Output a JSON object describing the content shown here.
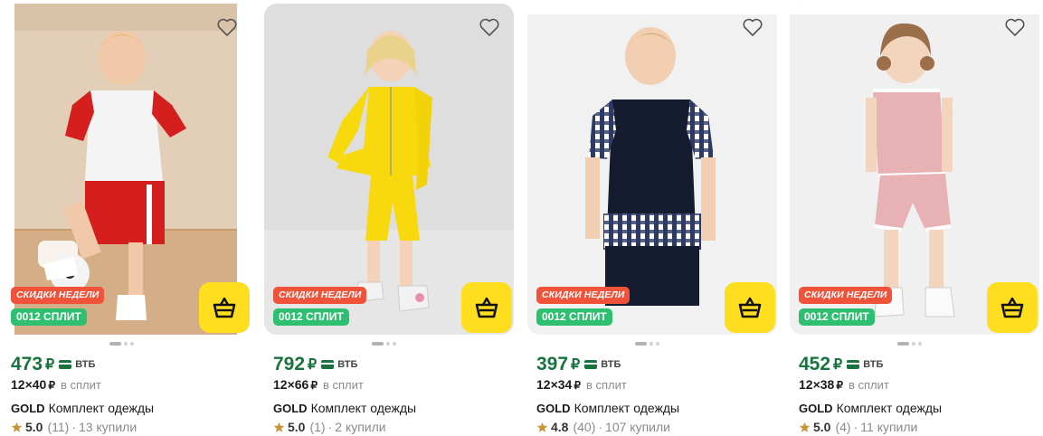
{
  "products": [
    {
      "price": "473",
      "currency": "₽",
      "bank": "ВТБ",
      "split_amount": "12×40",
      "split_currency": "₽",
      "split_label": "в сплит",
      "brand": "GOLD",
      "title": "Комплект одежды",
      "rating": "5.0",
      "reviews": "(11)",
      "separator": "·",
      "bought": "13 купили",
      "badge_sale": "СКИДКИ НЕДЕЛИ",
      "badge_split": "0012 СПЛИТ"
    },
    {
      "price": "792",
      "currency": "₽",
      "bank": "ВТБ",
      "split_amount": "12×66",
      "split_currency": "₽",
      "split_label": "в сплит",
      "brand": "GOLD",
      "title": "Комплект одежды",
      "rating": "5.0",
      "reviews": "(1)",
      "separator": "·",
      "bought": "2 купили",
      "badge_sale": "СКИДКИ НЕДЕЛИ",
      "badge_split": "0012 СПЛИТ"
    },
    {
      "price": "397",
      "currency": "₽",
      "bank": "ВТБ",
      "split_amount": "12×34",
      "split_currency": "₽",
      "split_label": "в сплит",
      "brand": "GOLD",
      "title": "Комплект одежды",
      "rating": "4.8",
      "reviews": "(40)",
      "separator": "·",
      "bought": "107 купили",
      "badge_sale": "СКИДКИ НЕДЕЛИ",
      "badge_split": "0012 СПЛИТ"
    },
    {
      "price": "452",
      "currency": "₽",
      "bank": "ВТБ",
      "split_amount": "12×38",
      "split_currency": "₽",
      "split_label": "в сплит",
      "brand": "GOLD",
      "title": "Комплект одежды",
      "rating": "5.0",
      "reviews": "(4)",
      "separator": "·",
      "bought": "11 купили",
      "badge_sale": "СКИДКИ НЕДЕЛИ",
      "badge_split": "0012 СПЛИТ"
    }
  ],
  "icons": {
    "favorite": "heart-outline-icon",
    "cart": "shopping-basket-icon",
    "bank": "bank-card-icon",
    "rating": "star-icon"
  },
  "colors": {
    "price": "#19733f",
    "badge_sale": "#f0523a",
    "badge_split": "#2fbf71",
    "cart_button": "#ffdd1f",
    "star": "#c8973a"
  }
}
